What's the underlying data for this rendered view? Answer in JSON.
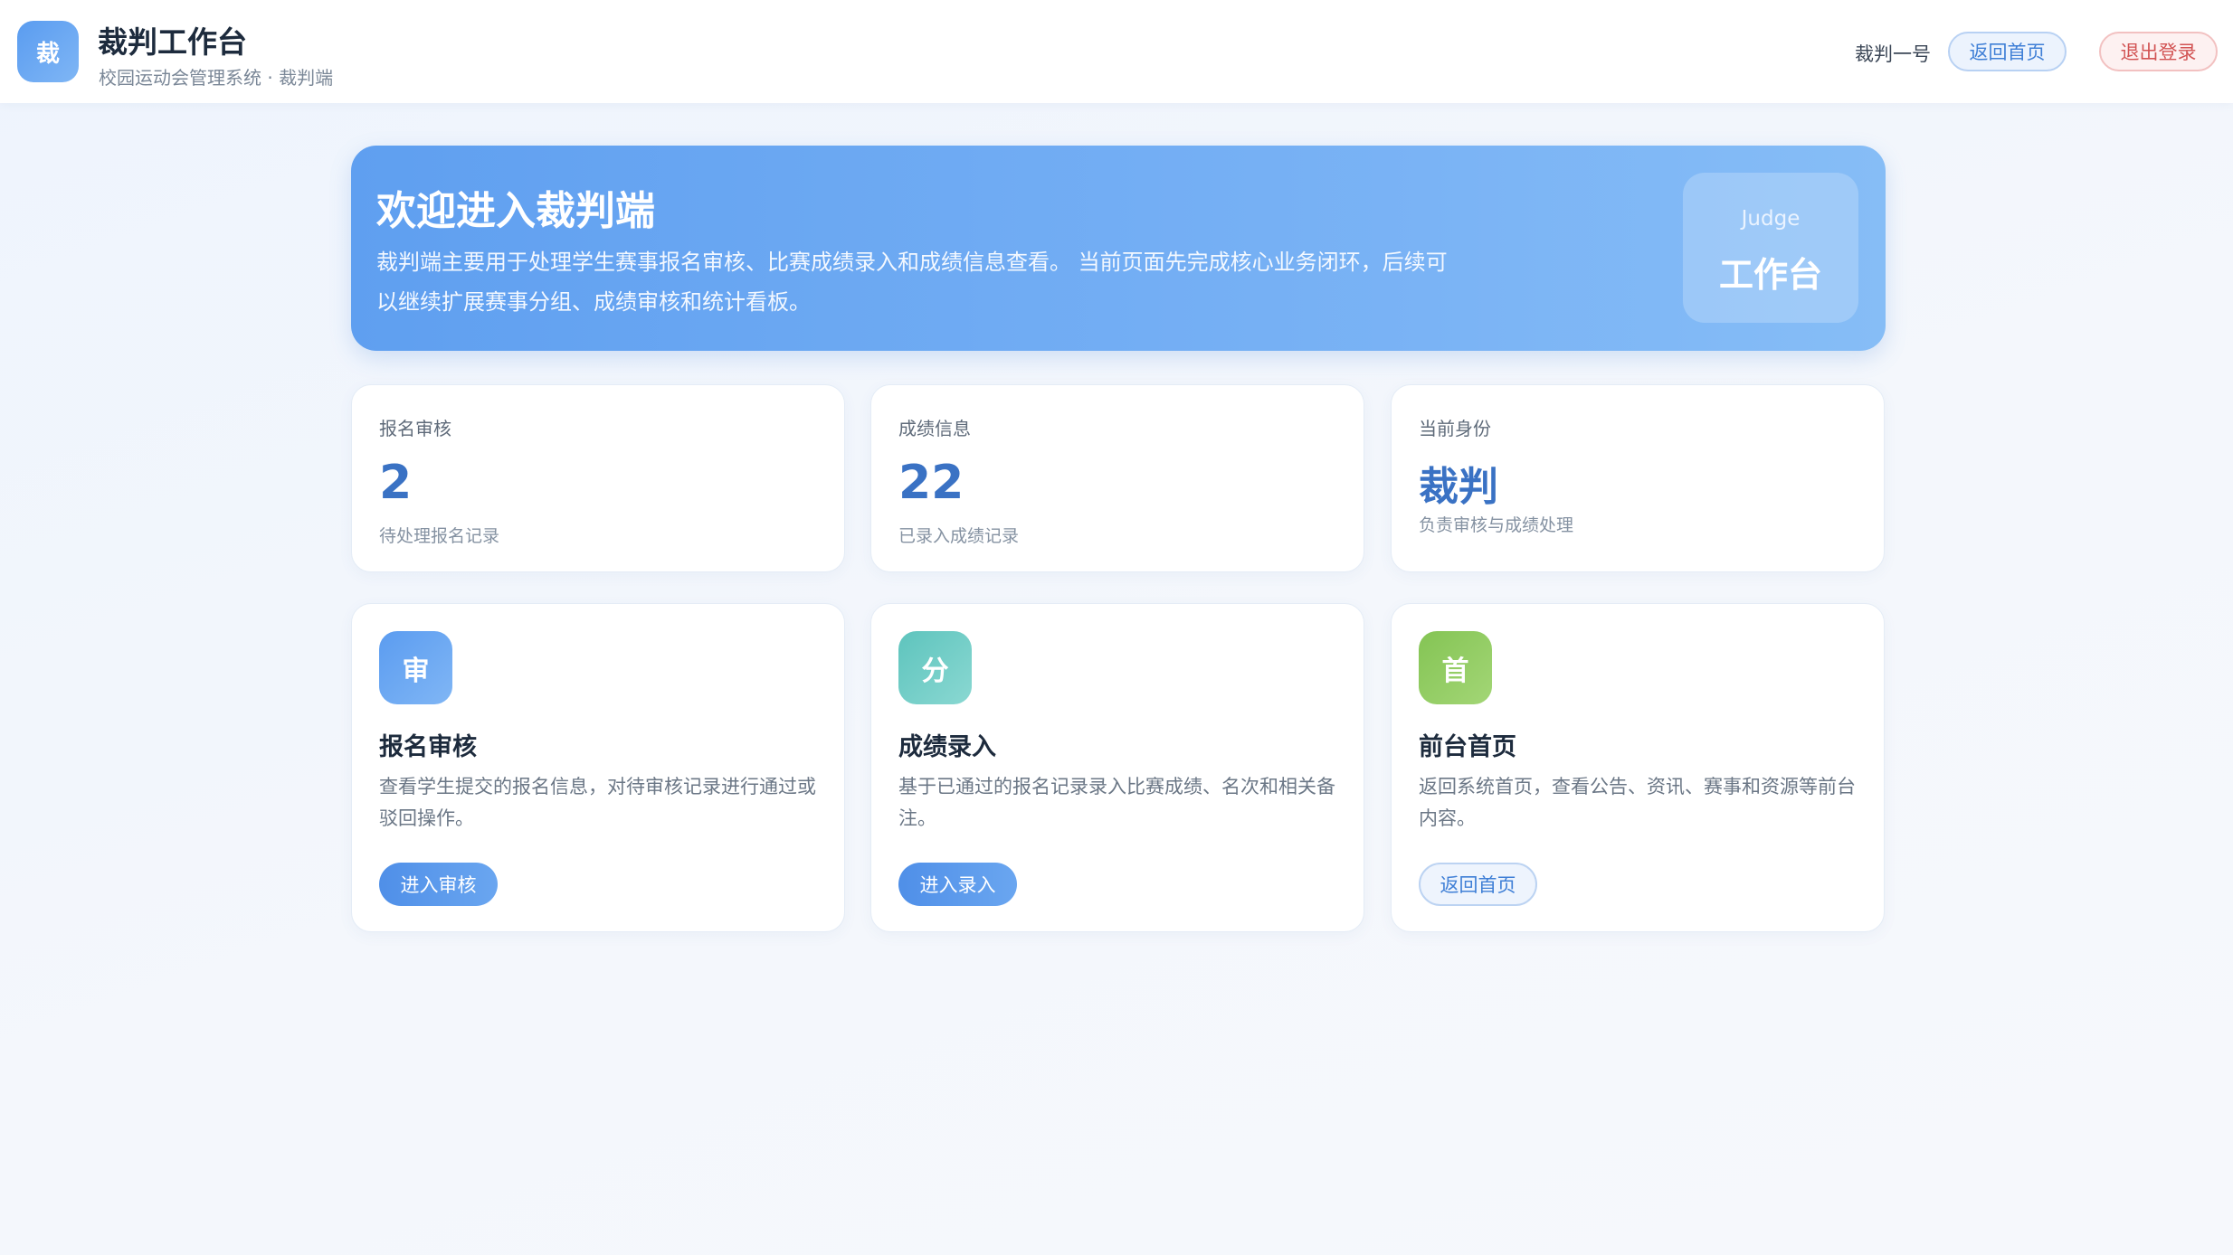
{
  "header": {
    "logo_char": "裁",
    "title": "裁判工作台",
    "subtitle": "校园运动会管理系统 · 裁判端",
    "user_name": "裁判一号",
    "home_button": "返回首页",
    "logout_button": "退出登录"
  },
  "hero": {
    "title": "欢迎进入裁判端",
    "description": "裁判端主要用于处理学生赛事报名审核、比赛成绩录入和成绩信息查看。 当前页面先完成核心业务闭环，后续可以继续扩展赛事分组、成绩审核和统计看板。",
    "badge_en": "Judge",
    "badge_cn": "工作台"
  },
  "stats": [
    {
      "label": "报名审核",
      "value": "2",
      "note": "待处理报名记录"
    },
    {
      "label": "成绩信息",
      "value": "22",
      "note": "已录入成绩记录"
    },
    {
      "label": "当前身份",
      "value": "裁判",
      "note": "负责审核与成绩处理"
    }
  ],
  "features": [
    {
      "icon_char": "审",
      "icon_name": "review-icon",
      "title": "报名审核",
      "description": "查看学生提交的报名信息，对待审核记录进行通过或驳回操作。",
      "button": "进入审核"
    },
    {
      "icon_char": "分",
      "icon_name": "score-icon",
      "title": "成绩录入",
      "description": "基于已通过的报名记录录入比赛成绩、名次和相关备注。",
      "button": "进入录入"
    },
    {
      "icon_char": "首",
      "icon_name": "home-icon",
      "title": "前台首页",
      "description": "返回系统首页，查看公告、资讯、赛事和资源等前台内容。",
      "button": "返回首页"
    }
  ],
  "colors": {
    "accent": "#5b9cf0",
    "stat_value": "#3a72c4",
    "logout": "#d25454",
    "icon_teal": "#5ec4bd",
    "icon_green": "#84c454"
  }
}
